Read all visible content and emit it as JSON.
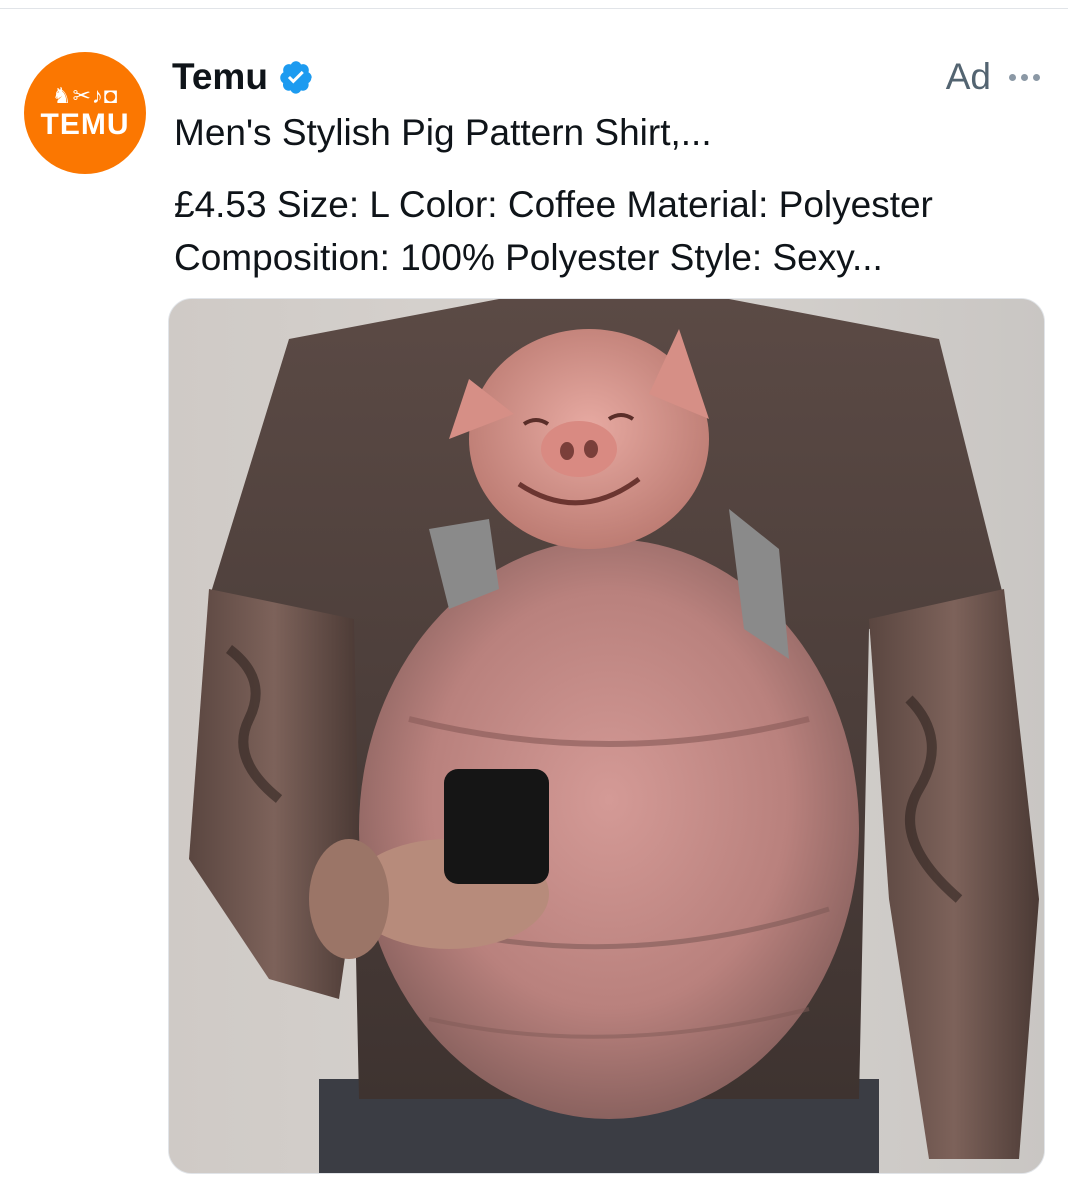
{
  "advertiser": {
    "name": "Temu",
    "logo_text": "TEMU",
    "verified": true,
    "verified_icon": "verified-badge-icon"
  },
  "ad": {
    "label": "Ad",
    "more_icon": "more-horizontal-icon",
    "headline": "Men's Stylish Pig Pattern Shirt,...",
    "description": "£4.53 Size: L Color: Coffee Material: Polyester Composition: 100% Polyester Style: Sexy..."
  },
  "colors": {
    "brand": "#fb7701",
    "verified": "#1d9bf0",
    "text": "#0f1419",
    "secondary_text": "#536471"
  }
}
